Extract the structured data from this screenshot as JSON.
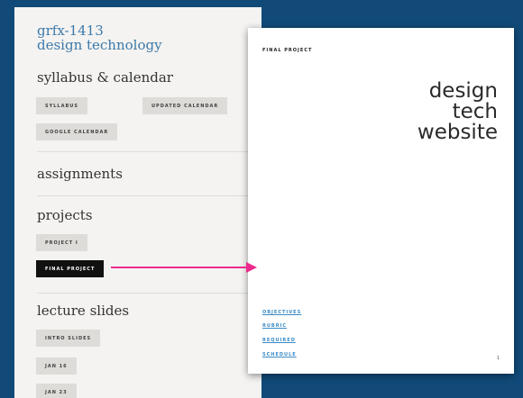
{
  "site": {
    "title_line1": "grfx-1413",
    "title_line2": "design technology",
    "sections": {
      "syllabus": "syllabus & calendar",
      "assignments": "assignments",
      "projects": "projects",
      "lecture_slides": "lecture slides"
    },
    "buttons": {
      "syllabus": "SYLLABUS",
      "updated_calendar": "UPDATED CALENDAR",
      "google_calendar": "GOOGLE CALENDAR",
      "project_1": "PROJECT I",
      "final_project": "FINAL PROJECT",
      "intro_slides": "INTRO SLIDES",
      "jan_16": "JAN 16",
      "jan_23": "JAN 23"
    }
  },
  "doc": {
    "label": "FINAL PROJECT",
    "title_lines": [
      "design",
      "tech",
      "website"
    ],
    "links": [
      "OBJECTIVES",
      "RUBRIC",
      "REQUIRED",
      "SCHEDULE"
    ],
    "page_number": "1"
  },
  "colors": {
    "background": "#114a78",
    "link": "#3a8bc6",
    "title": "#3c79aa",
    "arrow": "#ec2a8d",
    "active_button": "#111111"
  }
}
